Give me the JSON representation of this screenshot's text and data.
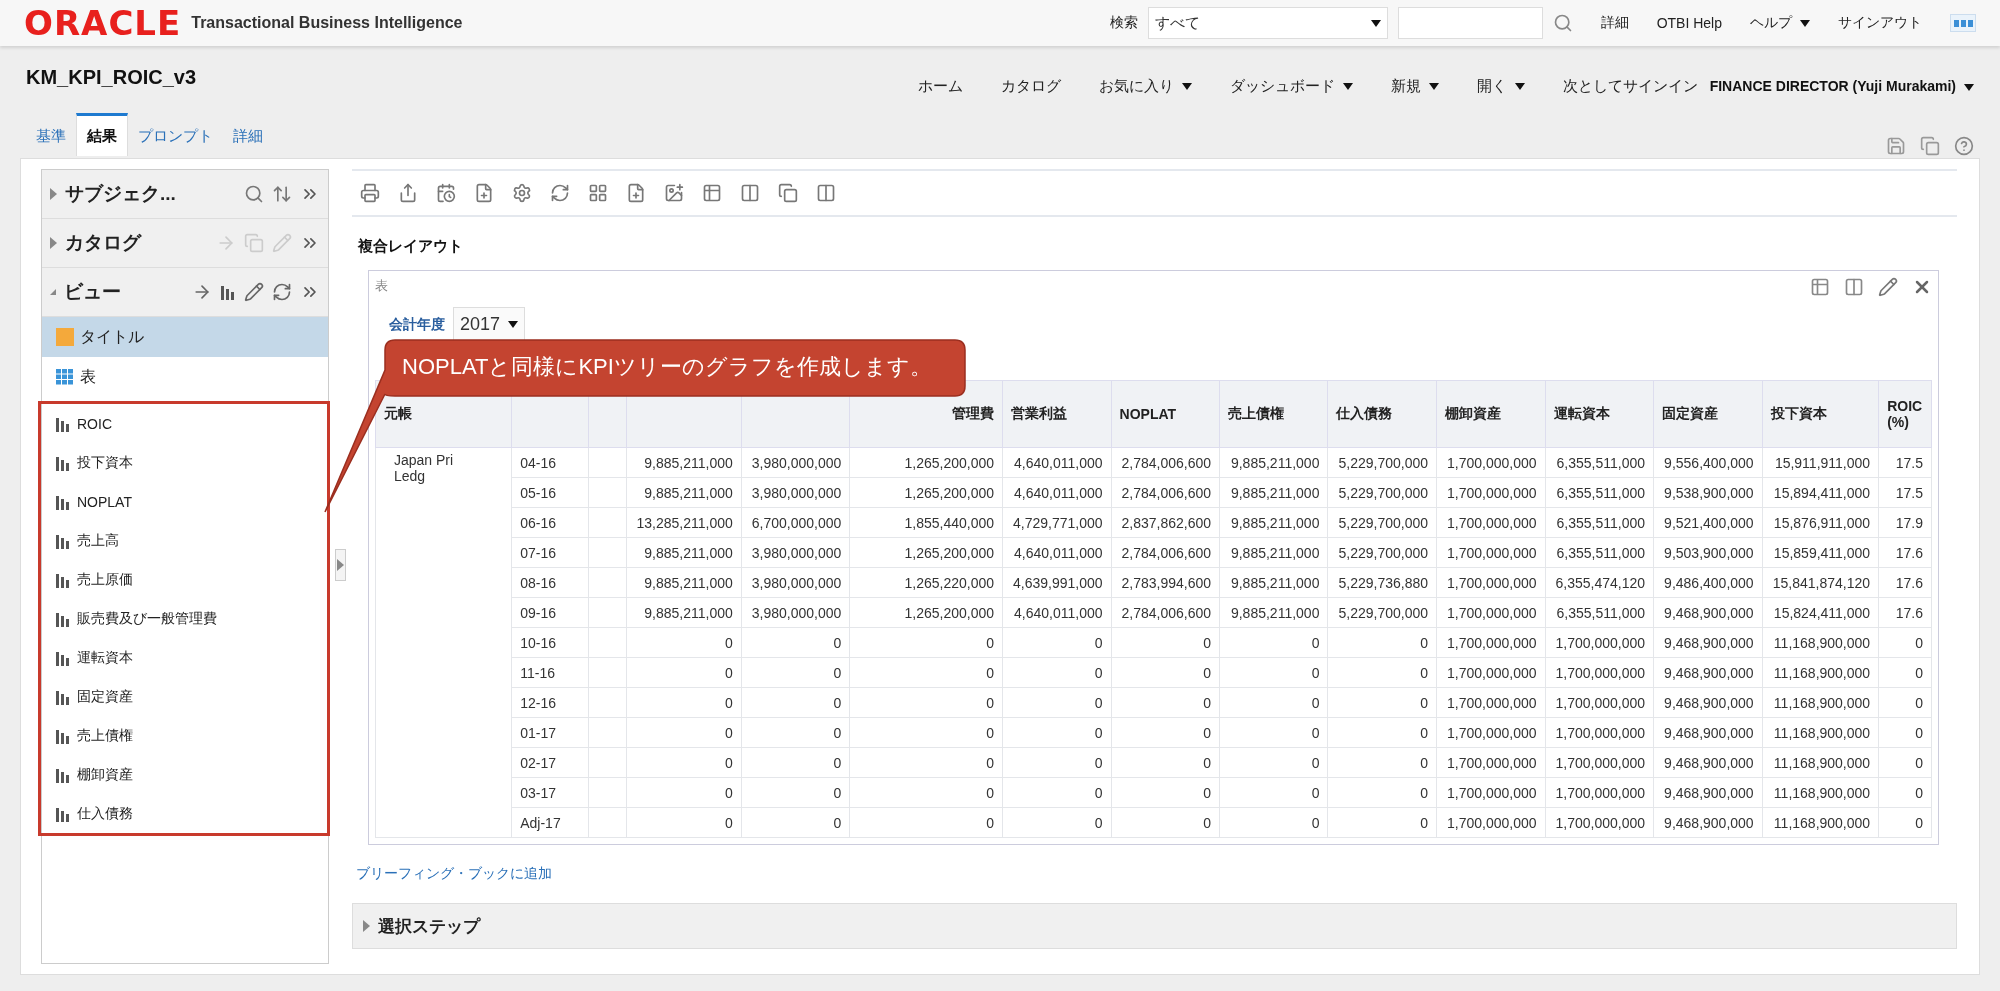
{
  "header": {
    "logo": "ORACLE",
    "product": "Transactional Business Intelligence",
    "search_label": "検索",
    "search_scope": "すべて",
    "links": [
      {
        "label": "詳細",
        "dropdown": false
      },
      {
        "label": "OTBI Help",
        "dropdown": false
      },
      {
        "label": "ヘルプ",
        "dropdown": true
      },
      {
        "label": "サインアウト",
        "dropdown": false
      }
    ]
  },
  "page_title": "KM_KPI_ROIC_v3",
  "nav": [
    {
      "label": "ホーム",
      "dropdown": false
    },
    {
      "label": "カタログ",
      "dropdown": false
    },
    {
      "label": "お気に入り",
      "dropdown": true
    },
    {
      "label": "ダッシュボード",
      "dropdown": true
    },
    {
      "label": "新規",
      "dropdown": true
    },
    {
      "label": "開く",
      "dropdown": true
    }
  ],
  "signed_in_label": "次としてサインイン",
  "user": "FINANCE DIRECTOR (Yuji Murakami)",
  "tabs": [
    {
      "label": "基準",
      "selected": false
    },
    {
      "label": "結果",
      "selected": true
    },
    {
      "label": "プロンプト",
      "selected": false
    },
    {
      "label": "詳細",
      "selected": false
    }
  ],
  "panes": [
    {
      "title": "サブジェク...",
      "expanded": false
    },
    {
      "title": "カタログ",
      "expanded": false
    },
    {
      "title": "ビュー",
      "expanded": true
    }
  ],
  "views": [
    {
      "label": "タイトル",
      "kind": "title",
      "selected": true
    },
    {
      "label": "表",
      "kind": "table",
      "selected": false
    },
    {
      "label": "ROIC",
      "kind": "chart",
      "selected": false
    },
    {
      "label": "投下資本",
      "kind": "chart",
      "selected": false
    },
    {
      "label": "NOPLAT",
      "kind": "chart",
      "selected": false
    },
    {
      "label": "売上高",
      "kind": "chart",
      "selected": false
    },
    {
      "label": "売上原価",
      "kind": "chart",
      "selected": false
    },
    {
      "label": "販売費及び一般管理費",
      "kind": "chart",
      "selected": false
    },
    {
      "label": "運転資本",
      "kind": "chart",
      "selected": false
    },
    {
      "label": "固定資産",
      "kind": "chart",
      "selected": false
    },
    {
      "label": "売上債権",
      "kind": "chart",
      "selected": false
    },
    {
      "label": "棚卸資産",
      "kind": "chart",
      "selected": false
    },
    {
      "label": "仕入債務",
      "kind": "chart",
      "selected": false
    }
  ],
  "layout_title": "複合レイアウト",
  "view_label": "表",
  "prompt": {
    "label": "会計年度",
    "value": "2017"
  },
  "table": {
    "columns": [
      {
        "label": "元帳"
      },
      {},
      {},
      {},
      {},
      {
        "label": "管理費"
      },
      {
        "label": "営業利益"
      },
      {
        "label": "NOPLAT"
      },
      {
        "label": "売上債権"
      },
      {
        "label": "仕入債務"
      },
      {
        "label": "棚卸資産"
      },
      {
        "label": "運転資本"
      },
      {
        "label": "固定資産"
      },
      {
        "label": "投下資本"
      },
      {
        "label": "ROIC (%)"
      }
    ],
    "entity": "Japan Pri Ledg",
    "rows": [
      {
        "period": "04-16",
        "values": [
          "9,885,211,000",
          "3,980,000,000",
          "1,265,200,000",
          "4,640,011,000",
          "2,784,006,600",
          "9,885,211,000",
          "5,229,700,000",
          "1,700,000,000",
          "6,355,511,000",
          "9,556,400,000",
          "15,911,911,000",
          "17.5"
        ]
      },
      {
        "period": "05-16",
        "values": [
          "9,885,211,000",
          "3,980,000,000",
          "1,265,200,000",
          "4,640,011,000",
          "2,784,006,600",
          "9,885,211,000",
          "5,229,700,000",
          "1,700,000,000",
          "6,355,511,000",
          "9,538,900,000",
          "15,894,411,000",
          "17.5"
        ]
      },
      {
        "period": "06-16",
        "values": [
          "13,285,211,000",
          "6,700,000,000",
          "1,855,440,000",
          "4,729,771,000",
          "2,837,862,600",
          "9,885,211,000",
          "5,229,700,000",
          "1,700,000,000",
          "6,355,511,000",
          "9,521,400,000",
          "15,876,911,000",
          "17.9"
        ]
      },
      {
        "period": "07-16",
        "values": [
          "9,885,211,000",
          "3,980,000,000",
          "1,265,200,000",
          "4,640,011,000",
          "2,784,006,600",
          "9,885,211,000",
          "5,229,700,000",
          "1,700,000,000",
          "6,355,511,000",
          "9,503,900,000",
          "15,859,411,000",
          "17.6"
        ]
      },
      {
        "period": "08-16",
        "values": [
          "9,885,211,000",
          "3,980,000,000",
          "1,265,220,000",
          "4,639,991,000",
          "2,783,994,600",
          "9,885,211,000",
          "5,229,736,880",
          "1,700,000,000",
          "6,355,474,120",
          "9,486,400,000",
          "15,841,874,120",
          "17.6"
        ]
      },
      {
        "period": "09-16",
        "values": [
          "9,885,211,000",
          "3,980,000,000",
          "1,265,200,000",
          "4,640,011,000",
          "2,784,006,600",
          "9,885,211,000",
          "5,229,700,000",
          "1,700,000,000",
          "6,355,511,000",
          "9,468,900,000",
          "15,824,411,000",
          "17.6"
        ]
      },
      {
        "period": "10-16",
        "values": [
          "0",
          "0",
          "0",
          "0",
          "0",
          "0",
          "0",
          "1,700,000,000",
          "1,700,000,000",
          "9,468,900,000",
          "11,168,900,000",
          "0"
        ]
      },
      {
        "period": "11-16",
        "values": [
          "0",
          "0",
          "0",
          "0",
          "0",
          "0",
          "0",
          "1,700,000,000",
          "1,700,000,000",
          "9,468,900,000",
          "11,168,900,000",
          "0"
        ]
      },
      {
        "period": "12-16",
        "values": [
          "0",
          "0",
          "0",
          "0",
          "0",
          "0",
          "0",
          "1,700,000,000",
          "1,700,000,000",
          "9,468,900,000",
          "11,168,900,000",
          "0"
        ]
      },
      {
        "period": "01-17",
        "values": [
          "0",
          "0",
          "0",
          "0",
          "0",
          "0",
          "0",
          "1,700,000,000",
          "1,700,000,000",
          "9,468,900,000",
          "11,168,900,000",
          "0"
        ]
      },
      {
        "period": "02-17",
        "values": [
          "0",
          "0",
          "0",
          "0",
          "0",
          "0",
          "0",
          "1,700,000,000",
          "1,700,000,000",
          "9,468,900,000",
          "11,168,900,000",
          "0"
        ]
      },
      {
        "period": "03-17",
        "values": [
          "0",
          "0",
          "0",
          "0",
          "0",
          "0",
          "0",
          "1,700,000,000",
          "1,700,000,000",
          "9,468,900,000",
          "11,168,900,000",
          "0"
        ]
      },
      {
        "period": "Adj-17",
        "values": [
          "0",
          "0",
          "0",
          "0",
          "0",
          "0",
          "0",
          "1,700,000,000",
          "1,700,000,000",
          "9,468,900,000",
          "11,168,900,000",
          "0"
        ]
      }
    ]
  },
  "briefing_link": "ブリーフィング・ブックに追加",
  "selection_steps": {
    "title": "選択ステップ",
    "expanded": false
  },
  "callout": "NOPLATと同様にKPIツリーのグラフを作成します。"
}
